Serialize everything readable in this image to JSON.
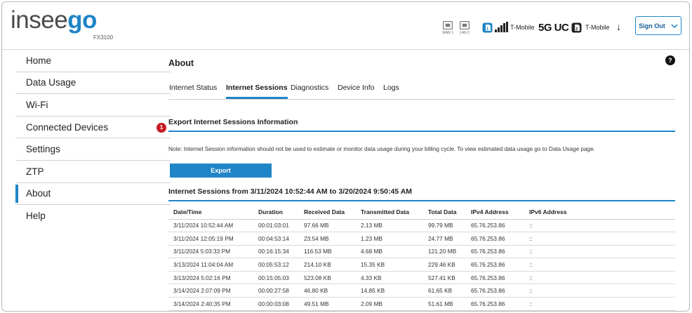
{
  "header": {
    "logo_part1": "insee",
    "logo_part2": "go",
    "model": "FX3100",
    "ports": [
      {
        "label": "WAN 1"
      },
      {
        "label": "LAN 2"
      }
    ],
    "sim1_carrier": "T-Mobile",
    "network_type": "5G UC",
    "sim2_carrier": "T-Mobile",
    "signout_label": "Sign Out",
    "accent_color": "#1f85c7"
  },
  "sidebar": {
    "items": [
      {
        "label": "Home"
      },
      {
        "label": "Data Usage"
      },
      {
        "label": "Wi-Fi"
      },
      {
        "label": "Connected Devices",
        "badge": "1"
      },
      {
        "label": "Settings"
      },
      {
        "label": "ZTP"
      },
      {
        "label": "About"
      },
      {
        "label": "Help"
      }
    ],
    "active": "About"
  },
  "main": {
    "title": "About",
    "help_glyph": "?",
    "tabs": [
      {
        "label": "Internet Status"
      },
      {
        "label": "Internet Sessions"
      },
      {
        "label": "Diagnostics"
      },
      {
        "label": "Device Info"
      },
      {
        "label": "Logs"
      }
    ],
    "active_tab": "Internet Sessions",
    "export_section_title": "Export Internet Sessions Information",
    "note": "Note: Internet Session information should not be used to estimate or monitor data usage during your billing cycle. To view estimated data usage go to Data Usage page.",
    "export_button": "Export",
    "sessions_title": "Internet Sessions from 3/11/2024 10:52:44 AM to 3/20/2024 9:50:45 AM",
    "table": {
      "columns": [
        "Date/Time",
        "Duration",
        "Received Data",
        "Transmitted Data",
        "Total Data",
        "IPv4 Address",
        "IPv6 Address"
      ],
      "rows": [
        [
          "3/11/2024 10:52:44 AM",
          "00:01:03:01",
          "97.66 MB",
          "2.13 MB",
          "99.79 MB",
          "65.76.253.86",
          "::"
        ],
        [
          "3/11/2024 12:05:19 PM",
          "00:04:53:14",
          "23.54 MB",
          "1.23 MB",
          "24.77 MB",
          "65.76.253.86",
          "::"
        ],
        [
          "3/11/2024 5:03:33 PM",
          "00:16:15:34",
          "116.53 MB",
          "4.68 MB",
          "121.20 MB",
          "65.76.253.86",
          "::"
        ],
        [
          "3/13/2024 11:04:04 AM",
          "00:05:53:12",
          "214.10 KB",
          "15.35 KB",
          "229.46 KB",
          "65.76.253.86",
          "::"
        ],
        [
          "3/13/2024 5:02:16 PM",
          "00:15:05:03",
          "523.08 KB",
          "4.33 KB",
          "527.41 KB",
          "65.76.253.86",
          "::"
        ],
        [
          "3/14/2024 2:07:09 PM",
          "00:00:27:58",
          "46.80 KB",
          "14.85 KB",
          "61.65 KB",
          "65.76.253.86",
          "::"
        ],
        [
          "3/14/2024 2:40:35 PM",
          "00:00:03:08",
          "49.51 MB",
          "2.09 MB",
          "51.61 MB",
          "65.76.253.86",
          "::"
        ]
      ]
    }
  }
}
